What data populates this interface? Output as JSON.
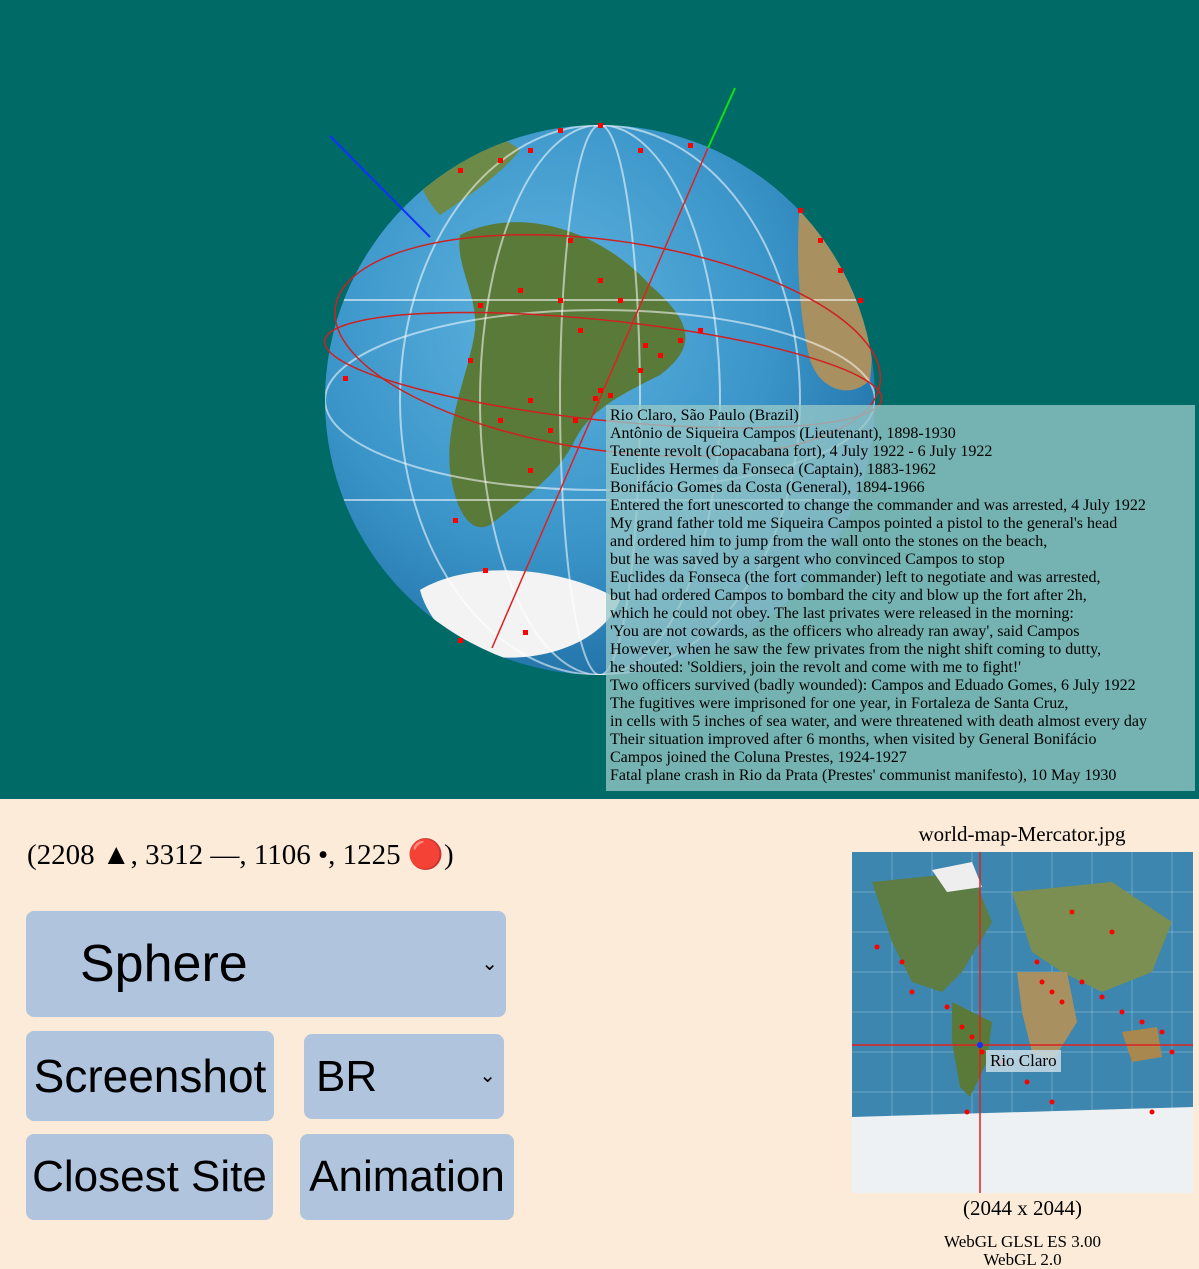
{
  "globe": {
    "tooltip_lines": [
      "Rio Claro, São Paulo (Brazil)",
      "Antônio de Siqueira Campos (Lieutenant), 1898-1930",
      "Tenente revolt (Copacabana fort), 4 July 1922 - 6 July 1922",
      "Euclides Hermes da Fonseca (Captain), 1883-1962",
      "Bonifácio Gomes da Costa (General), 1894-1966",
      "Entered the fort unescorted to change the commander and was arrested, 4 July 1922",
      "My grand father told me Siqueira Campos pointed a pistol to the general's head",
      "and ordered him to jump from the wall onto the stones on the beach,",
      "but he was saved by a sargent who convinced Campos to stop",
      "Euclides da Fonseca (the fort commander) left to negotiate and was arrested,",
      "but had ordered Campos to bombard the city and blow up the fort after 2h,",
      "which he could not obey. The last privates were released in the morning:",
      "'You are not cowards, as the officers who already ran away', said Campos",
      "However, when he saw the few privates from the night shift coming to dutty,",
      "he shouted: 'Soldiers, join the revolt and come with me to fight!'",
      "Two officers survived (badly wounded): Campos and Eduado Gomes, 6 July 1922",
      "The fugitives were imprisoned for one year, in Fortaleza de Santa Cruz,",
      "in cells with 5 inches of sea water, and were threatened with death almost every day",
      "Their situation improved after 6 months, when visited by General Bonifácio",
      "Campos joined the Coluna Prestes, 1924-1927",
      "Fatal plane crash in Rio da Prata (Prestes' communist manifesto), 10 May 1930"
    ]
  },
  "stats": {
    "text": "(2208 ▲, 3312 —, 1106 •, 1225 🔴)"
  },
  "controls": {
    "shape_select": "Sphere",
    "screenshot_label": "Screenshot",
    "country_select": "BR",
    "closest_label": "Closest Site",
    "animation_label": "Animation",
    "chevron": "⌄"
  },
  "minimap": {
    "title": "world-map-Mercator.jpg",
    "label": "Rio Claro",
    "dims": "(2044 x 2044)"
  },
  "webgl": {
    "line1": "WebGL GLSL ES 3.00",
    "line2": "WebGL 2.0"
  },
  "colors": {
    "background": "#006a67",
    "panel": "#fbebd8",
    "button": "#b0c4de",
    "marker": "#ff0000"
  }
}
